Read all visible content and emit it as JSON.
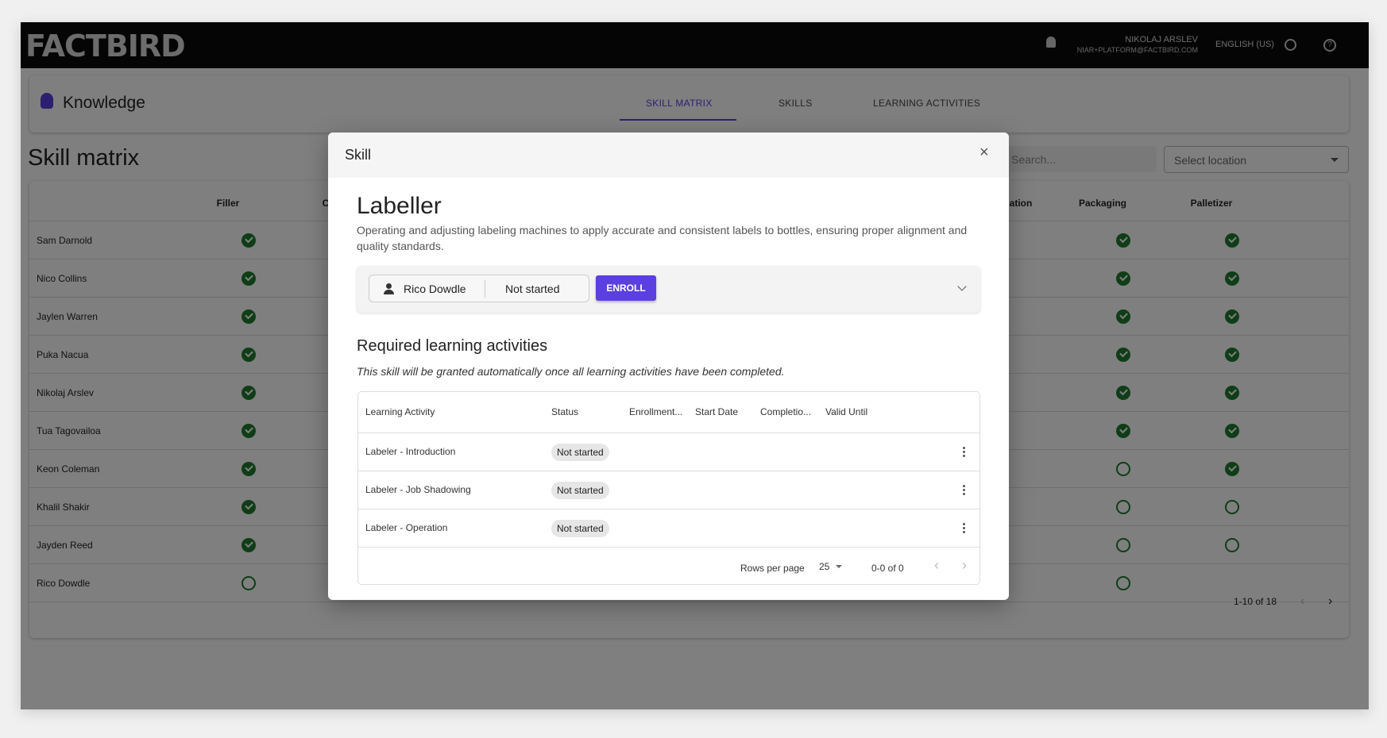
{
  "topbar": {
    "logo": "FACTBIRD",
    "user_name": "NIKOLAJ ARSLEV",
    "user_email": "NIAR+PLATFORM@FACTBIRD.COM",
    "language": "ENGLISH (US)"
  },
  "module": {
    "title": "Knowledge",
    "tabs": [
      {
        "label": "SKILL MATRIX",
        "active": true
      },
      {
        "label": "SKILLS"
      },
      {
        "label": "LEARNING ACTIVITIES"
      }
    ]
  },
  "page": {
    "title": "Skill matrix",
    "search_placeholder": "Search...",
    "location_placeholder": "Select location"
  },
  "matrix": {
    "columns": [
      "Filler",
      "C",
      "ation",
      "Packaging",
      "Palletizer"
    ],
    "rows": [
      {
        "name": "Sam Darnold",
        "filler": "done",
        "packaging": "done",
        "palletizer": "done"
      },
      {
        "name": "Nico Collins",
        "filler": "done",
        "packaging": "done",
        "palletizer": "done"
      },
      {
        "name": "Jaylen Warren",
        "filler": "done",
        "packaging": "done",
        "palletizer": "done"
      },
      {
        "name": "Puka Nacua",
        "filler": "done",
        "packaging": "done",
        "palletizer": "done"
      },
      {
        "name": "Nikolaj Arslev",
        "filler": "done",
        "packaging": "done",
        "palletizer": "done"
      },
      {
        "name": "Tua Tagovailoa",
        "filler": "done",
        "packaging": "done",
        "palletizer": "done"
      },
      {
        "name": "Keon Coleman",
        "filler": "done",
        "packaging": "todo",
        "palletizer": "done"
      },
      {
        "name": "Khalil Shakir",
        "filler": "done",
        "packaging": "todo",
        "palletizer": "todo"
      },
      {
        "name": "Jayden Reed",
        "filler": "done",
        "packaging": "todo",
        "palletizer": "todo"
      },
      {
        "name": "Rico Dowdle",
        "filler": "todo",
        "packaging": "todo",
        "palletizer": ""
      }
    ],
    "pagination": "1-10 of 18"
  },
  "modal": {
    "title": "Skill",
    "skill_name": "Labeller",
    "description": "Operating and adjusting labeling machines to apply accurate and consistent labels to bottles, ensuring proper alignment and quality standards.",
    "enrollment": {
      "person": "Rico Dowdle",
      "status": "Not started",
      "button": "ENROLL"
    },
    "section_title": "Required learning activities",
    "note": "This skill will be granted automatically once all learning activities have been completed.",
    "table": {
      "headers": [
        "Learning Activity",
        "Status",
        "Enrollment...",
        "Start Date",
        "Completio...",
        "Valid Until"
      ],
      "rows": [
        {
          "activity": "Labeler - Introduction",
          "status": "Not started"
        },
        {
          "activity": "Labeler - Job Shadowing",
          "status": "Not started"
        },
        {
          "activity": "Labeler - Operation",
          "status": "Not started"
        }
      ],
      "rows_per_page_label": "Rows per page",
      "rows_per_page": "25",
      "range": "0-0 of 0"
    }
  },
  "colors": {
    "accent": "#5b3fe0",
    "success": "#1f7a2e",
    "topbar": "#0a0a0a"
  }
}
